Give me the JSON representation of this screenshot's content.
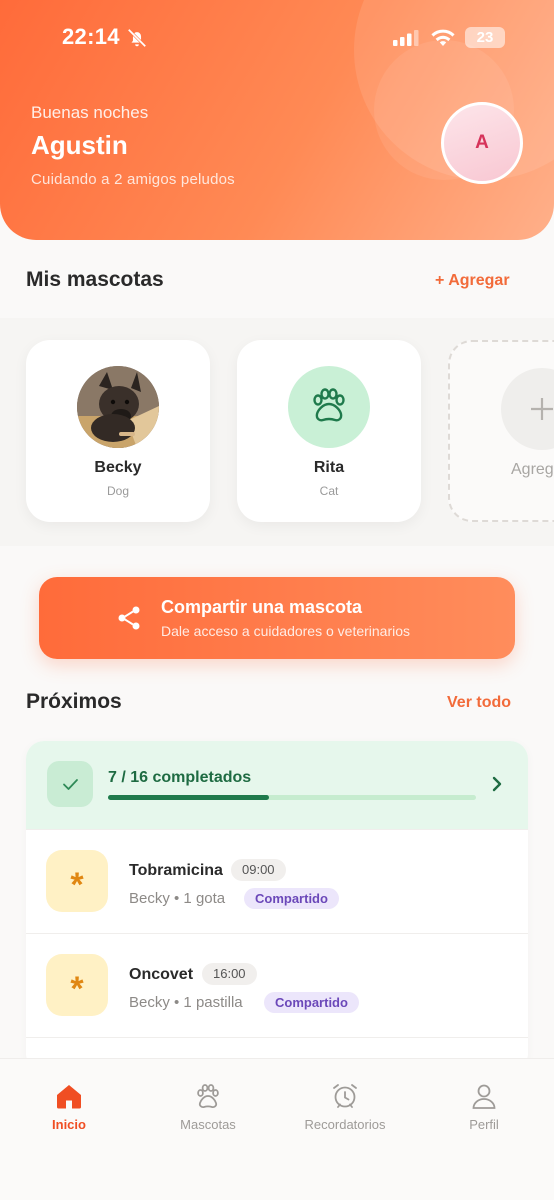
{
  "status_bar": {
    "time": "22:14",
    "battery": "23"
  },
  "header": {
    "greeting": "Buenas noches",
    "user_name": "Agustin",
    "subtitle": "Cuidando a 2 amigos peludos",
    "avatar_initial": "A"
  },
  "pets_section": {
    "title": "Mis mascotas",
    "add_link": "+ Agregar",
    "pets": [
      {
        "name": "Becky",
        "type": "Dog"
      },
      {
        "name": "Rita",
        "type": "Cat"
      }
    ],
    "add_card_label": "Agreg"
  },
  "share_banner": {
    "title": "Compartir una mascota",
    "subtitle": "Dale acceso a cuidadores o veterinarios"
  },
  "upcoming": {
    "title": "Próximos",
    "see_all": "Ver todo",
    "progress": {
      "label": "7 / 16 completados",
      "completed": 7,
      "total": 16
    },
    "reminders": [
      {
        "title": "Tobramicina",
        "time": "09:00",
        "detail": "Becky • 1 gota",
        "badge": "Compartido"
      },
      {
        "title": "Oncovet",
        "time": "16:00",
        "detail": "Becky • 1 pastilla",
        "badge": "Compartido"
      }
    ]
  },
  "bottom_nav": {
    "items": [
      {
        "label": "Inicio",
        "icon": "home-icon",
        "active": true
      },
      {
        "label": "Mascotas",
        "icon": "paw-icon",
        "active": false
      },
      {
        "label": "Recordatorios",
        "icon": "alarm-clock-icon",
        "active": false
      },
      {
        "label": "Perfil",
        "icon": "person-icon",
        "active": false
      }
    ]
  },
  "colors": {
    "accent": "#ff6b3a",
    "success": "#1f7a4c",
    "badge": "#6b48b9"
  }
}
